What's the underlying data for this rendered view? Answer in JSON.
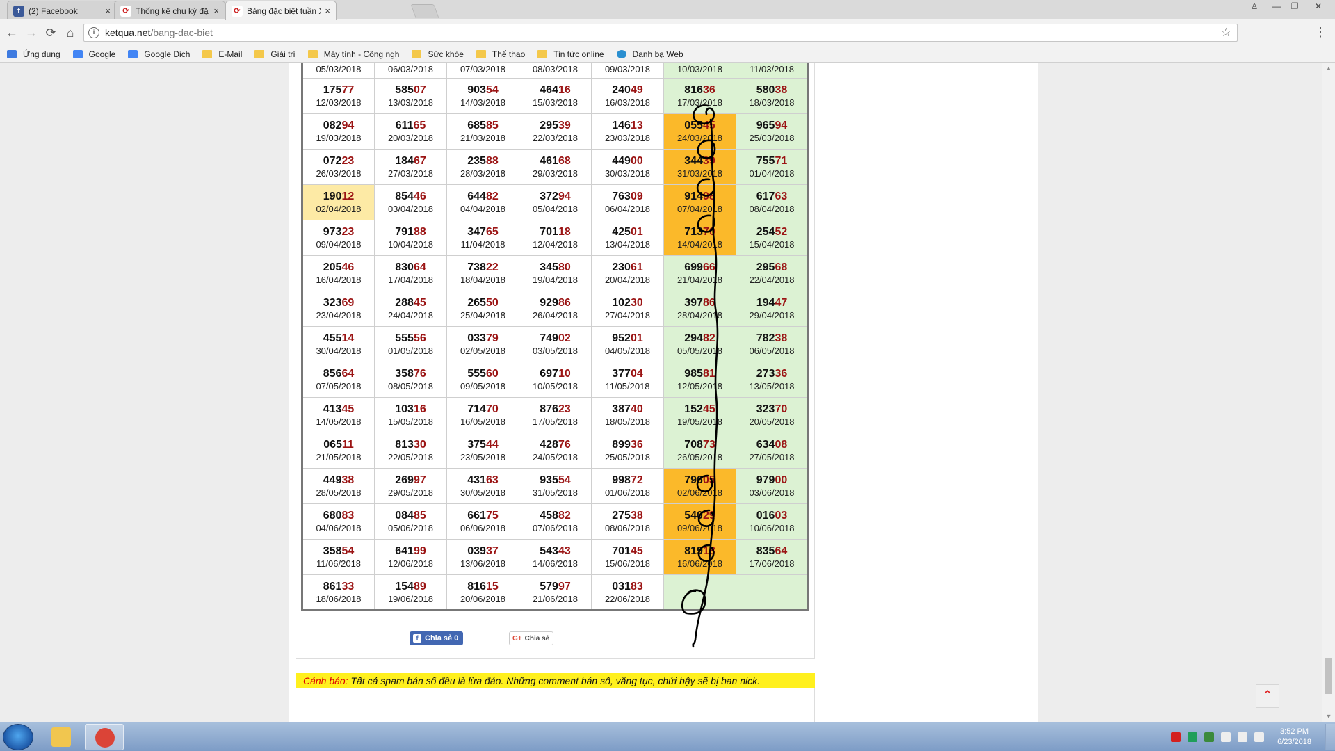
{
  "browser": {
    "tabs": [
      {
        "title": "(2) Facebook",
        "active": false,
        "icon": "facebook-icon",
        "icon_glyph": "f",
        "icon_color": "#3b5998"
      },
      {
        "title": "Thống kê chu kỳ đặc biệt",
        "active": false,
        "icon": "ketqua-icon",
        "icon_glyph": "⟳",
        "icon_color": "#cc1f1f"
      },
      {
        "title": "Bảng đặc biệt tuần Xổ Số",
        "active": true,
        "icon": "ketqua-icon",
        "icon_glyph": "⟳",
        "icon_color": "#cc1f1f"
      }
    ],
    "close_glyph": "×",
    "window_buttons": [
      "♙",
      "—",
      "❐",
      "✕"
    ],
    "url_host": "ketqua.net",
    "url_path": "/bang-dac-biet",
    "info_glyph": "i",
    "star_glyph": "☆",
    "menu_glyph": "⋮",
    "nav": {
      "back": "←",
      "forward": "→",
      "reload": "⟳",
      "home": "⌂"
    },
    "bookmarks": [
      {
        "label": "Ứng dụng",
        "icon": "apps-grid-icon",
        "color": "#3f7be0"
      },
      {
        "label": "Google",
        "icon": "google-icon",
        "color": "#4285f4"
      },
      {
        "label": "Google Dịch",
        "icon": "translate-icon",
        "color": "#4285f4"
      },
      {
        "label": "E-Mail",
        "icon": "folder-icon",
        "color": "#f4c84a"
      },
      {
        "label": "Giải trí",
        "icon": "folder-icon",
        "color": "#f4c84a"
      },
      {
        "label": "Máy tính - Công ngh",
        "icon": "folder-icon",
        "color": "#f4c84a"
      },
      {
        "label": "Sức khỏe",
        "icon": "folder-icon",
        "color": "#f4c84a"
      },
      {
        "label": "Thể thao",
        "icon": "folder-icon",
        "color": "#f4c84a"
      },
      {
        "label": "Tin tức online",
        "icon": "folder-icon",
        "color": "#f4c84a"
      },
      {
        "label": "Danh bạ Web",
        "icon": "compass-icon",
        "color": "#2a8fd0"
      }
    ]
  },
  "table": {
    "rows": [
      [
        {
          "n": "",
          "d": "05/03/2018"
        },
        {
          "n": "",
          "d": "06/03/2018"
        },
        {
          "n": "",
          "d": "07/03/2018"
        },
        {
          "n": "",
          "d": "08/03/2018"
        },
        {
          "n": "",
          "d": "09/03/2018"
        },
        {
          "n": "",
          "d": "10/03/2018"
        },
        {
          "n": "",
          "d": "11/03/2018"
        }
      ],
      [
        {
          "n": "17577",
          "d": "12/03/2018"
        },
        {
          "n": "58507",
          "d": "13/03/2018"
        },
        {
          "n": "90354",
          "d": "14/03/2018"
        },
        {
          "n": "46416",
          "d": "15/03/2018"
        },
        {
          "n": "24049",
          "d": "16/03/2018"
        },
        {
          "n": "81636",
          "d": "17/03/2018"
        },
        {
          "n": "58038",
          "d": "18/03/2018"
        }
      ],
      [
        {
          "n": "08294",
          "d": "19/03/2018"
        },
        {
          "n": "61165",
          "d": "20/03/2018"
        },
        {
          "n": "68585",
          "d": "21/03/2018"
        },
        {
          "n": "29539",
          "d": "22/03/2018"
        },
        {
          "n": "14613",
          "d": "23/03/2018"
        },
        {
          "n": "05545",
          "d": "24/03/2018",
          "hl": "hit"
        },
        {
          "n": "96594",
          "d": "25/03/2018"
        }
      ],
      [
        {
          "n": "07223",
          "d": "26/03/2018"
        },
        {
          "n": "18467",
          "d": "27/03/2018"
        },
        {
          "n": "23588",
          "d": "28/03/2018"
        },
        {
          "n": "46168",
          "d": "29/03/2018"
        },
        {
          "n": "44900",
          "d": "30/03/2018"
        },
        {
          "n": "34439",
          "d": "31/03/2018",
          "hl": "hit"
        },
        {
          "n": "75571",
          "d": "01/04/2018"
        }
      ],
      [
        {
          "n": "19012",
          "d": "02/04/2018",
          "hl": "lt"
        },
        {
          "n": "85446",
          "d": "03/04/2018"
        },
        {
          "n": "64482",
          "d": "04/04/2018"
        },
        {
          "n": "37294",
          "d": "05/04/2018"
        },
        {
          "n": "76309",
          "d": "06/04/2018"
        },
        {
          "n": "91498",
          "d": "07/04/2018",
          "hl": "hit"
        },
        {
          "n": "61763",
          "d": "08/04/2018"
        }
      ],
      [
        {
          "n": "97323",
          "d": "09/04/2018"
        },
        {
          "n": "79188",
          "d": "10/04/2018"
        },
        {
          "n": "34765",
          "d": "11/04/2018"
        },
        {
          "n": "70118",
          "d": "12/04/2018"
        },
        {
          "n": "42501",
          "d": "13/04/2018"
        },
        {
          "n": "71370",
          "d": "14/04/2018",
          "hl": "hit"
        },
        {
          "n": "25452",
          "d": "15/04/2018"
        }
      ],
      [
        {
          "n": "20546",
          "d": "16/04/2018"
        },
        {
          "n": "83064",
          "d": "17/04/2018"
        },
        {
          "n": "73822",
          "d": "18/04/2018"
        },
        {
          "n": "34580",
          "d": "19/04/2018"
        },
        {
          "n": "23061",
          "d": "20/04/2018"
        },
        {
          "n": "69966",
          "d": "21/04/2018"
        },
        {
          "n": "29568",
          "d": "22/04/2018"
        }
      ],
      [
        {
          "n": "32369",
          "d": "23/04/2018"
        },
        {
          "n": "28845",
          "d": "24/04/2018"
        },
        {
          "n": "26550",
          "d": "25/04/2018"
        },
        {
          "n": "92986",
          "d": "26/04/2018"
        },
        {
          "n": "10230",
          "d": "27/04/2018"
        },
        {
          "n": "39786",
          "d": "28/04/2018"
        },
        {
          "n": "19447",
          "d": "29/04/2018"
        }
      ],
      [
        {
          "n": "45514",
          "d": "30/04/2018"
        },
        {
          "n": "55556",
          "d": "01/05/2018"
        },
        {
          "n": "03379",
          "d": "02/05/2018"
        },
        {
          "n": "74902",
          "d": "03/05/2018"
        },
        {
          "n": "95201",
          "d": "04/05/2018"
        },
        {
          "n": "29482",
          "d": "05/05/2018"
        },
        {
          "n": "78238",
          "d": "06/05/2018"
        }
      ],
      [
        {
          "n": "85664",
          "d": "07/05/2018"
        },
        {
          "n": "35876",
          "d": "08/05/2018"
        },
        {
          "n": "55560",
          "d": "09/05/2018"
        },
        {
          "n": "69710",
          "d": "10/05/2018"
        },
        {
          "n": "37704",
          "d": "11/05/2018"
        },
        {
          "n": "98581",
          "d": "12/05/2018"
        },
        {
          "n": "27336",
          "d": "13/05/2018"
        }
      ],
      [
        {
          "n": "41345",
          "d": "14/05/2018"
        },
        {
          "n": "10316",
          "d": "15/05/2018"
        },
        {
          "n": "71470",
          "d": "16/05/2018"
        },
        {
          "n": "87623",
          "d": "17/05/2018"
        },
        {
          "n": "38740",
          "d": "18/05/2018"
        },
        {
          "n": "15245",
          "d": "19/05/2018"
        },
        {
          "n": "32370",
          "d": "20/05/2018"
        }
      ],
      [
        {
          "n": "06511",
          "d": "21/05/2018"
        },
        {
          "n": "81330",
          "d": "22/05/2018"
        },
        {
          "n": "37544",
          "d": "23/05/2018"
        },
        {
          "n": "42876",
          "d": "24/05/2018"
        },
        {
          "n": "89936",
          "d": "25/05/2018"
        },
        {
          "n": "70873",
          "d": "26/05/2018"
        },
        {
          "n": "63408",
          "d": "27/05/2018"
        }
      ],
      [
        {
          "n": "44938",
          "d": "28/05/2018"
        },
        {
          "n": "26997",
          "d": "29/05/2018"
        },
        {
          "n": "43163",
          "d": "30/05/2018"
        },
        {
          "n": "93554",
          "d": "31/05/2018"
        },
        {
          "n": "99872",
          "d": "01/06/2018"
        },
        {
          "n": "79605",
          "d": "02/06/2018",
          "hl": "hit"
        },
        {
          "n": "97900",
          "d": "03/06/2018"
        }
      ],
      [
        {
          "n": "68083",
          "d": "04/06/2018"
        },
        {
          "n": "08485",
          "d": "05/06/2018"
        },
        {
          "n": "66175",
          "d": "06/06/2018"
        },
        {
          "n": "45882",
          "d": "07/06/2018"
        },
        {
          "n": "27538",
          "d": "08/06/2018"
        },
        {
          "n": "54029",
          "d": "09/06/2018",
          "hl": "hit"
        },
        {
          "n": "01603",
          "d": "10/06/2018"
        }
      ],
      [
        {
          "n": "35854",
          "d": "11/06/2018"
        },
        {
          "n": "64199",
          "d": "12/06/2018"
        },
        {
          "n": "03937",
          "d": "13/06/2018"
        },
        {
          "n": "54343",
          "d": "14/06/2018"
        },
        {
          "n": "70145",
          "d": "15/06/2018"
        },
        {
          "n": "81918",
          "d": "16/06/2018",
          "hl": "hit"
        },
        {
          "n": "83564",
          "d": "17/06/2018"
        }
      ],
      [
        {
          "n": "86133",
          "d": "18/06/2018"
        },
        {
          "n": "15489",
          "d": "19/06/2018"
        },
        {
          "n": "81615",
          "d": "20/06/2018"
        },
        {
          "n": "57997",
          "d": "21/06/2018"
        },
        {
          "n": "03183",
          "d": "22/06/2018"
        },
        {
          "n": "",
          "d": ""
        },
        {
          "n": "",
          "d": ""
        }
      ]
    ]
  },
  "share": {
    "facebook_label": "Chia sẻ 0",
    "facebook_glyph": "f",
    "gplus_label": "Chia sẻ",
    "gplus_glyph": "G+"
  },
  "warning": {
    "label": "Cảnh báo:",
    "text": " Tất cả spam bán số đều là lừa đảo. Những comment bán số, văng tục, chửi bậy sẽ bị ban nick."
  },
  "scroll_top_glyph": "⌃",
  "taskbar": {
    "items": [
      {
        "name": "file-explorer-icon",
        "color": "#f1c64f"
      },
      {
        "name": "chrome-icon",
        "color": "#db4437"
      }
    ],
    "tray_icons": [
      {
        "name": "antivirus-icon",
        "color": "#d42020"
      },
      {
        "name": "network-app-icon",
        "color": "#1f9e5a"
      },
      {
        "name": "sync-icon",
        "color": "#3b8a3b"
      },
      {
        "name": "flag-icon",
        "color": "#eeeeee"
      },
      {
        "name": "speaker-icon",
        "color": "#eeeeee"
      },
      {
        "name": "network-icon",
        "color": "#eeeeee"
      }
    ],
    "time": "3:52 PM",
    "date": "6/23/2018"
  },
  "colors": {
    "hit": "#fbb92a",
    "light_hit": "#fdeaa5",
    "weekend": "#dcf2d3",
    "tail_digits": "#9b1414",
    "ink": "#000000"
  }
}
